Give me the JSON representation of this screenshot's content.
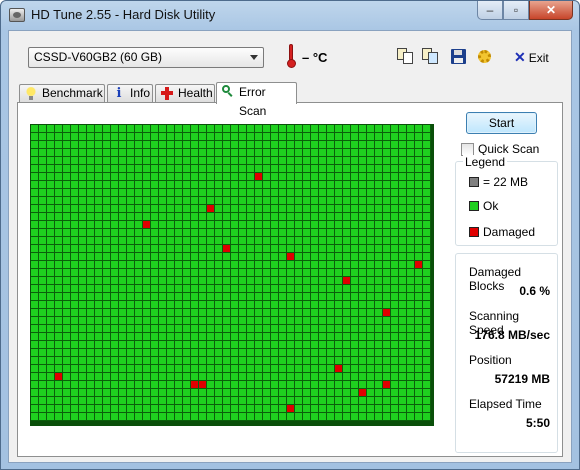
{
  "window": {
    "title": "HD Tune 2.55 - Hard Disk Utility"
  },
  "toolbar": {
    "drive": "CSSD-V60GB2 (60 GB)",
    "temperature": "– °C",
    "exit_label": "Exit",
    "icons": [
      "copy-info-icon",
      "copy-screenshot-icon",
      "save-icon",
      "options-icon"
    ]
  },
  "tabs": [
    {
      "label": "Benchmark",
      "icon": "lightbulb-icon"
    },
    {
      "label": "Info",
      "icon": "info-icon"
    },
    {
      "label": "Health",
      "icon": "health-cross-icon"
    },
    {
      "label": "Error Scan",
      "icon": "magnifier-icon",
      "active": true
    }
  ],
  "scan": {
    "start_label": "Start",
    "quick_scan_label": "Quick Scan",
    "quick_scan_checked": false
  },
  "legend": {
    "title": "Legend",
    "block_size": "= 22 MB",
    "ok": "Ok",
    "damaged": "Damaged",
    "colors": {
      "block": "#808080",
      "ok": "#1fd01f",
      "damaged": "#e00000"
    }
  },
  "stats": {
    "damaged_blocks_label": "Damaged Blocks",
    "damaged_blocks_value": "0.6 %",
    "speed_label": "Scanning Speed",
    "speed_value": "176.8 MB/sec",
    "position_label": "Position",
    "position_value": "57219 MB",
    "elapsed_label": "Elapsed Time",
    "elapsed_value": "5:50"
  },
  "error_map": {
    "columns": 50,
    "rows": 37,
    "damaged_cells": [
      [
        6,
        28
      ],
      [
        10,
        22
      ],
      [
        12,
        14
      ],
      [
        15,
        24
      ],
      [
        16,
        32
      ],
      [
        17,
        48
      ],
      [
        19,
        39
      ],
      [
        23,
        44
      ],
      [
        30,
        38
      ],
      [
        31,
        3
      ],
      [
        32,
        20
      ],
      [
        32,
        21
      ],
      [
        32,
        44
      ],
      [
        33,
        41
      ],
      [
        35,
        32
      ]
    ]
  }
}
